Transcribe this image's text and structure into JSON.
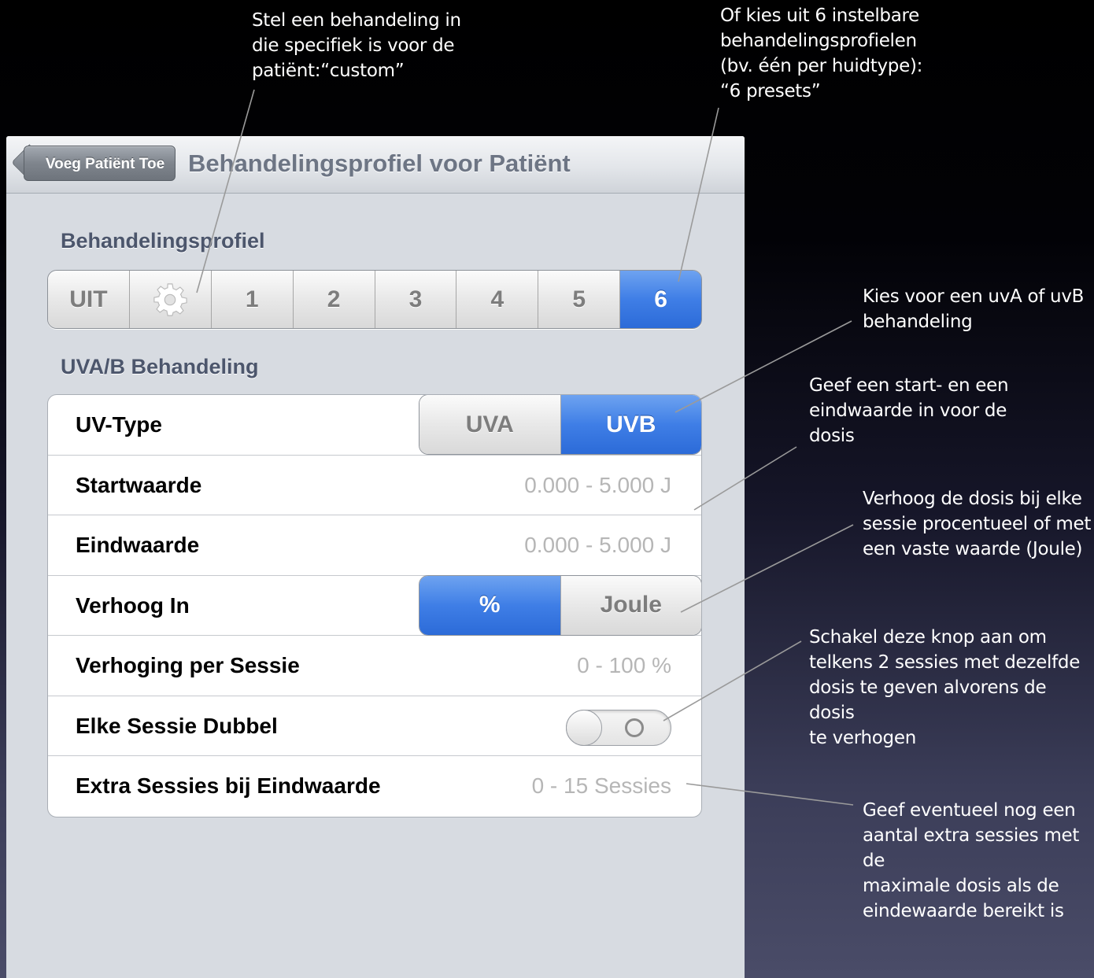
{
  "annotations": {
    "custom": "Stel een behandeling in\ndie specifiek is voor de\npatiënt:“custom”",
    "presets": "Of kies uit 6 instelbare\nbehandelingsprofielen\n(bv. één per huidtype):\n“6 presets”",
    "uv_type": "Kies voor een uvA of uvB\nbehandeling",
    "start_end": "Geef een start- en een\neindwaarde in voor de\ndosis",
    "increase": "Verhoog de dosis bij elke\nsessie procentueel of met\neen vaste waarde (Joule)",
    "double": "Schakel deze knop aan om\ntelkens 2 sessies met dezelfde\ndosis te geven alvorens de dosis\nte verhogen",
    "extra": "Geef eventueel nog een\naantal extra sessies met de\nmaximale dosis als de\neindewaarde bereikt is"
  },
  "navbar": {
    "back_label": "Voeg Patiënt Toe",
    "title": "Behandelingsprofiel voor Patiënt"
  },
  "profile": {
    "header": "Behandelingsprofiel",
    "segments": [
      "UIT",
      "gear-icon",
      "1",
      "2",
      "3",
      "4",
      "5",
      "6"
    ],
    "selected": "6"
  },
  "treatment": {
    "header": "UVA/B Behandeling",
    "rows": {
      "uv_type": {
        "label": "UV-Type",
        "options": [
          "UVA",
          "UVB"
        ],
        "selected": "UVB"
      },
      "start": {
        "label": "Startwaarde",
        "placeholder": "0.000 - 5.000 J"
      },
      "end": {
        "label": "Eindwaarde",
        "placeholder": "0.000 - 5.000 J"
      },
      "increase_in": {
        "label": "Verhoog In",
        "options": [
          "%",
          "Joule"
        ],
        "selected": "%"
      },
      "increase_per_session": {
        "label": "Verhoging per Sessie",
        "placeholder": "0 - 100 %"
      },
      "double_session": {
        "label": "Elke Sessie Dubbel",
        "toggle": "off"
      },
      "extra_sessions": {
        "label": "Extra Sessies bij Eindwaarde",
        "placeholder": "0 - 15 Sessies"
      }
    }
  },
  "colors": {
    "selected_blue": "#3f7ee6",
    "panel_bg": "#d7dbe1",
    "section_header": "#4c566c"
  }
}
